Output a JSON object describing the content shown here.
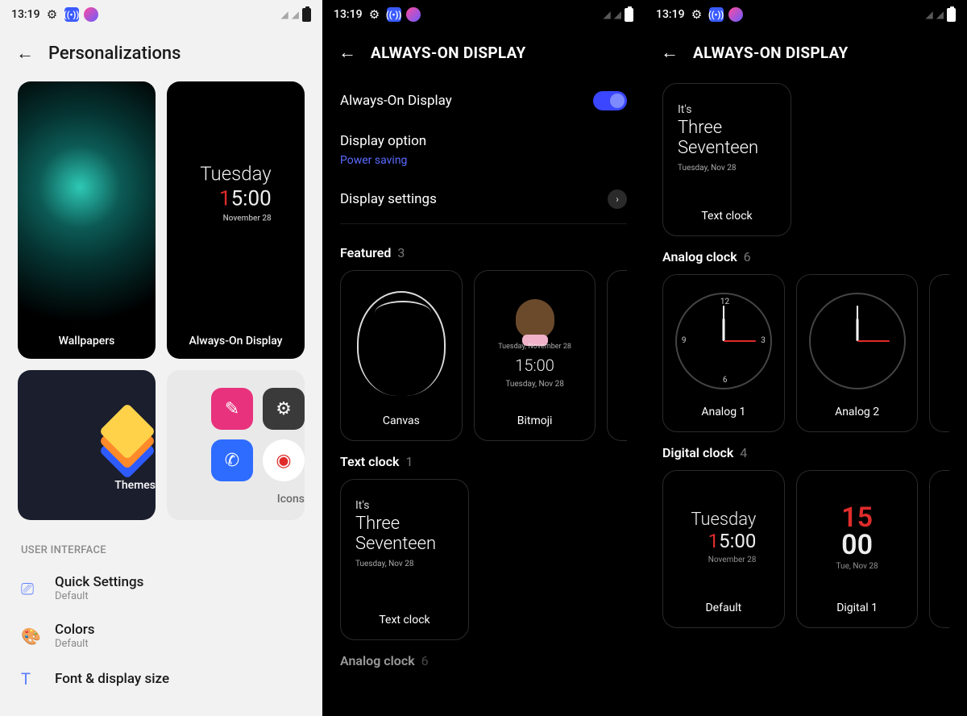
{
  "status": {
    "time": "13:19"
  },
  "screen1": {
    "title": "Personalizations",
    "tiles": {
      "wallpapers": "Wallpapers",
      "aod": "Always-On Display",
      "aod_preview": {
        "day": "Tuesday",
        "hour_red": "1",
        "hour_rest": "5:00",
        "date": "November 28"
      },
      "themes": "Themes",
      "icons": "Icons"
    },
    "section_ui": "USER INTERFACE",
    "items": [
      {
        "title": "Quick Settings",
        "sub": "Default"
      },
      {
        "title": "Colors",
        "sub": "Default"
      },
      {
        "title": "Font & display size",
        "sub": ""
      }
    ]
  },
  "screen2": {
    "title": "ALWAYS-ON DISPLAY",
    "rows": {
      "aod_toggle": "Always-On Display",
      "display_option": "Display option",
      "display_option_sub": "Power saving",
      "display_settings": "Display settings"
    },
    "featured": {
      "label": "Featured",
      "count": "3",
      "canvas": "Canvas",
      "bitmoji": "Bitmoji",
      "bitmoji_prev": {
        "line1": "Tuesday, November 28",
        "time": "15:00",
        "line2": "Tuesday, Nov 28"
      }
    },
    "text_clock": {
      "label": "Text clock",
      "count": "1",
      "its": "It's",
      "main": "Three\nSeventeen",
      "sub": "Tuesday, Nov 28",
      "cap": "Text clock"
    },
    "analog_peek": {
      "label": "Analog clock",
      "count": "6"
    }
  },
  "screen3": {
    "title": "ALWAYS-ON DISPLAY",
    "text_clock": {
      "its": "It's",
      "main": "Three\nSeventeen",
      "sub": "Tuesday, Nov 28",
      "cap": "Text clock"
    },
    "analog": {
      "label": "Analog clock",
      "count": "6",
      "items": [
        "Analog 1",
        "Analog 2"
      ]
    },
    "digital": {
      "label": "Digital clock",
      "count": "4",
      "default_prev": {
        "day": "Tuesday",
        "hr": "1",
        "rest": "5:00",
        "sub": "November 28"
      },
      "d1_prev": {
        "top": "15",
        "bot": "00",
        "sub": "Tue, Nov 28"
      },
      "caps": {
        "default": "Default",
        "d1": "Digital 1"
      }
    }
  }
}
